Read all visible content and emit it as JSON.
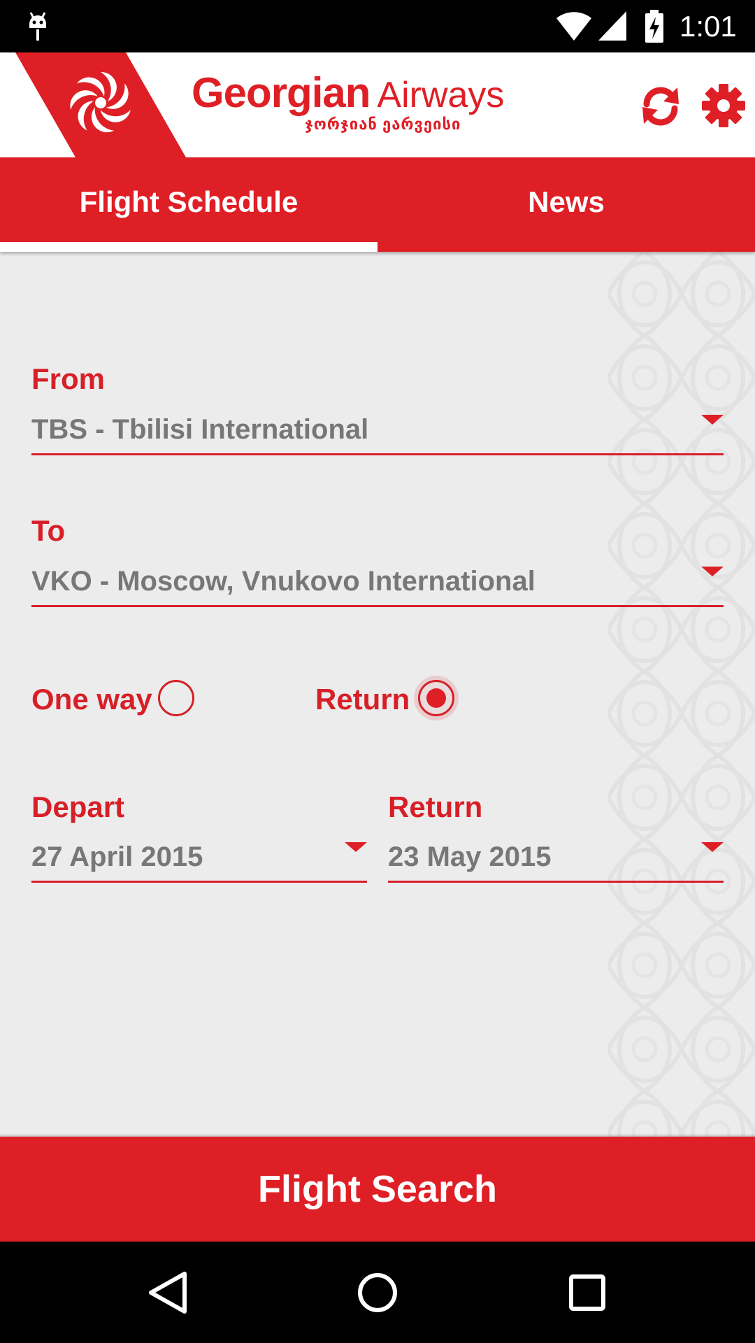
{
  "status_bar": {
    "time": "1:01",
    "icons": [
      "android-notification-icon",
      "wifi-icon",
      "cell-signal-icon",
      "battery-charging-icon"
    ]
  },
  "header": {
    "brand_bold": "Georgian",
    "brand_light": "Airways",
    "brand_subtitle": "ჯორჯიან ეარვეისი",
    "actions": [
      "refresh-icon",
      "settings-gear-icon"
    ],
    "accent_color": "#df1f26"
  },
  "tabs": [
    {
      "label": "Flight Schedule",
      "active": true
    },
    {
      "label": "News",
      "active": false
    }
  ],
  "form": {
    "from": {
      "label": "From",
      "value": "TBS - Tbilisi International"
    },
    "to": {
      "label": "To",
      "value": "VKO - Moscow, Vnukovo International"
    },
    "trip_type": {
      "one_way_label": "One way",
      "return_label": "Return",
      "selected": "Return"
    },
    "depart": {
      "label": "Depart",
      "value": "27 April 2015"
    },
    "return": {
      "label": "Return",
      "value": "23 May 2015"
    }
  },
  "search_button": {
    "label": "Flight Search"
  },
  "nav_bar": [
    "back-icon",
    "home-icon",
    "recents-icon"
  ]
}
